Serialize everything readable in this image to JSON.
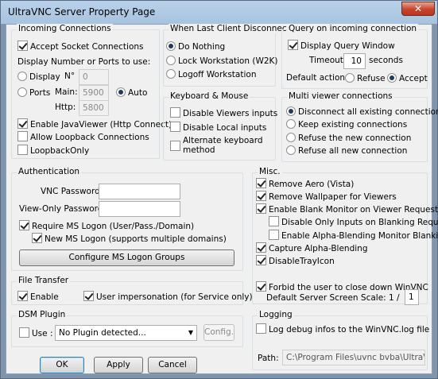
{
  "window": {
    "title": "UltraVNC Server Property Page",
    "close_glyph": "✕"
  },
  "incoming": {
    "title": "Incoming Connections",
    "accept_socket": "Accept Socket Connections",
    "display_ports_label": "Display Number or Ports to use:",
    "display": "Display",
    "display_no_label": "N°",
    "display_no_value": "0",
    "ports": "Ports",
    "main_label": "Main:",
    "main_value": "5900",
    "auto": "Auto",
    "http_label": "Http:",
    "http_value": "5800",
    "enable_javaviewer": "Enable JavaViewer (Http Connect)",
    "allow_loopback": "Allow Loopback Connections",
    "loopback_only": "LoopbackOnly"
  },
  "disconnect": {
    "title": "When Last Client Disconnects",
    "do_nothing": "Do Nothing",
    "lock": "Lock Workstation (W2K)",
    "logoff": "Logoff Workstation"
  },
  "query": {
    "title": "Query on incoming connection",
    "display_query": "Display Query Window",
    "timeout_label": "Timeout:",
    "timeout_value": "10",
    "seconds": "seconds",
    "default_action": "Default action:",
    "refuse": "Refuse",
    "accept": "Accept"
  },
  "keyboard": {
    "title": "Keyboard & Mouse",
    "disable_viewers": "Disable Viewers inputs",
    "disable_local": "Disable Local inputs",
    "alt_keyboard_1": "Alternate keyboard",
    "alt_keyboard_2": "method"
  },
  "multi": {
    "title": "Multi viewer connections",
    "disconnect_all": "Disconnect all existing connections",
    "keep": "Keep existing connections",
    "refuse_new": "Refuse the new connection",
    "refuse_all": "Refuse all new connection"
  },
  "auth": {
    "title": "Authentication",
    "vnc_password": "VNC Password:",
    "view_only_password": "View-Only Password:",
    "require_ms_logon": "Require MS Logon  (User/Pass./Domain)",
    "new_ms_logon": "New MS Logon (supports multiple domains)",
    "configure_groups": "Configure MS Logon Groups"
  },
  "misc": {
    "title": "Misc.",
    "remove_aero": "Remove Aero (Vista)",
    "remove_wallpaper": "Remove Wallpaper for Viewers",
    "enable_blank": "Enable Blank Monitor on Viewer Request",
    "disable_only_inputs": "Disable Only Inputs on Blanking Request",
    "alpha_blending_blanking": "Enable Alpha-Blending Monitor Blanking",
    "capture_alpha": "Capture Alpha-Blending",
    "disable_tray": "DisableTrayIcon",
    "forbid_close": "Forbid the user to close down WinVNC",
    "scale_label": "Default Server Screen Scale:",
    "scale_prefix": "1 /",
    "scale_value": "1"
  },
  "file_transfer": {
    "title": "File Transfer",
    "enable": "Enable",
    "user_impersonation": "User impersonation (for Service only)"
  },
  "dsm": {
    "title": "DSM Plugin",
    "use": "Use :",
    "plugin_value": "No Plugin detected...",
    "config": "Config."
  },
  "logging": {
    "title": "Logging",
    "log_debug": "Log debug infos to the WinVNC.log file",
    "path_label": "Path:",
    "path_value": "C:\\Program Files\\uvnc bvba\\UltraVnc"
  },
  "buttons": {
    "ok": "OK",
    "apply": "Apply",
    "cancel": "Cancel"
  }
}
